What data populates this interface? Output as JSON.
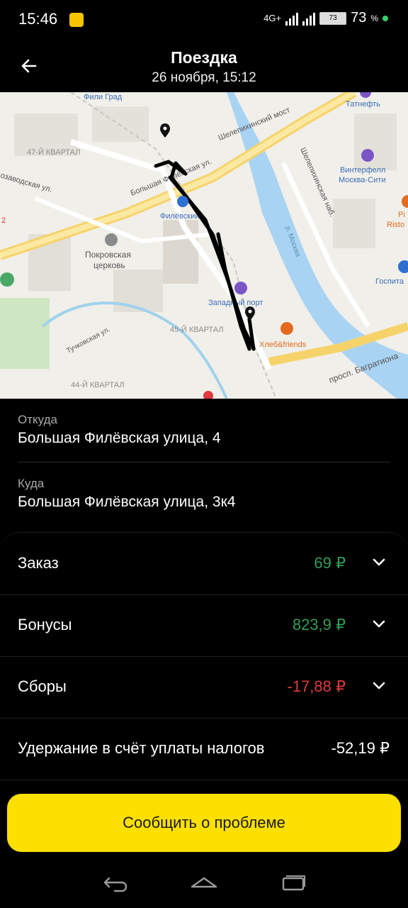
{
  "status_bar": {
    "time": "15:46",
    "network": "4G+",
    "battery_level": "73",
    "battery_percent": "73",
    "battery_percent_sign": "%"
  },
  "header": {
    "title": "Поездка",
    "subtitle": "26 ноября, 15:12"
  },
  "map": {
    "labels": {
      "fili_grad": "Фили Град",
      "tatneft": "Татнефть",
      "kvartal47": "47-Й КВАРТАЛ",
      "shelepikhinsky_most": "Шелепихинский мост",
      "bolshaya_filevskaya": "Большая Филёвская ул.",
      "shelepikhinskaya_nab": "Шелепихинская наб.",
      "wintefell": "Винтерфелл",
      "moskva_city": "Москва-Сити",
      "zavodskaya": "озаводская ул.",
      "filevsky": "Филёвский",
      "pi": "Pi",
      "risto": "Risto",
      "pokrovskaya": "Покровская",
      "tserkov": "церковь",
      "river": "р. Москва",
      "gospital": "Госпита",
      "zapadny_port": "Западный порт",
      "kvartal45": "45-Й КВАРТАЛ",
      "khleb_friends": "Хлеб&friends",
      "tuchkovskaya": "Тучковская ул.",
      "bagrationa": "просп. Багратиона",
      "kvartal44": "44-Й КВАРТАЛ",
      "num2": "2"
    }
  },
  "route": {
    "from_label": "Откуда",
    "from_value": "Большая Филёвская улица, 4",
    "to_label": "Куда",
    "to_value": "Большая Филёвская улица, 3к4"
  },
  "finance": {
    "rows": [
      {
        "label": "Заказ",
        "amount": "69 ₽"
      },
      {
        "label": "Бонусы",
        "amount": "823,9 ₽"
      },
      {
        "label": "Сборы",
        "amount": "-17,88 ₽"
      },
      {
        "label": "Удержание в счёт уплаты налогов",
        "amount": "-52,19 ₽"
      }
    ]
  },
  "actions": {
    "report_problem": "Сообщить о проблеме"
  },
  "colors": {
    "positive": "#2f9e5a",
    "negative": "#e0393e",
    "accent": "#fde000",
    "river": "#a9d3f2"
  },
  "icons": [
    "back-arrow-icon",
    "chevron-down-icon",
    "map-pin-icon",
    "nav-back-icon",
    "nav-home-icon",
    "nav-recents-icon"
  ]
}
